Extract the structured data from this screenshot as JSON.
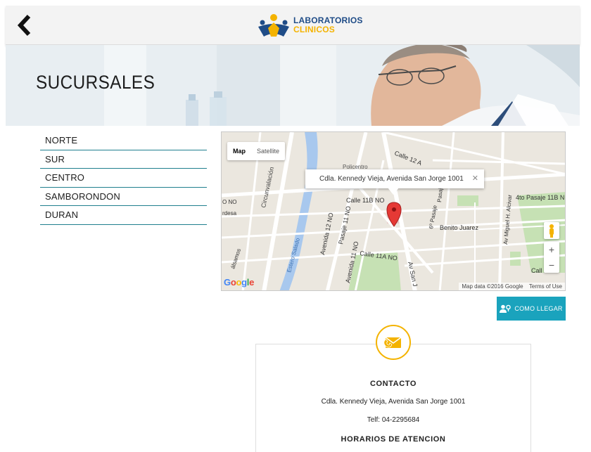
{
  "header": {
    "brand_line1": "LABORATORIOS",
    "brand_line2": "CLINICOS",
    "back_icon": "chevron-left-icon"
  },
  "hero": {
    "title": "SUCURSALES"
  },
  "branches": [
    "NORTE",
    "SUR",
    "CENTRO",
    "SAMBORONDON",
    "DURAN"
  ],
  "map": {
    "type_map": "Map",
    "type_satellite": "Satellite",
    "info_address": "Cdla. Kennedy Vieja, Avenida San Jorge 1001",
    "attribution": "Map data ©2016 Google",
    "terms": "Terms of Use",
    "google": "Google",
    "streets": {
      "policentro": "Policentro",
      "calle_12a": "Calle 12 A",
      "calle_11b": "Calle 11B NO",
      "calle_11a": "Calle 11A NO",
      "circunvalacion": "Circunvalación",
      "avenida_12": "Avenida 12 NO",
      "pasaje_11": "Pasaje 11 NO",
      "avenida_11": "Avenida 11 NO",
      "estero": "Estero Salado",
      "benito": "Benito Juarez",
      "pasaje_6": "6º Pasaje",
      "pasaje_9": "Pasaje 9",
      "av_miguel": "Av Miguel H. Alcivar",
      "pasaje_11b": "4to Pasaje 11B N",
      "av_san": "Av San J",
      "calle_short": "Call",
      "no": "O NO",
      "ardesa": "rdesa",
      "balsamos": "álsamos"
    },
    "zoom_in": "+",
    "zoom_out": "−",
    "colors": {
      "water": "#a8c8ee",
      "park": "#c6e1b4",
      "road": "#ffffff",
      "marker": "#e53935"
    }
  },
  "directions_button": "COMO LLEGAR",
  "contact": {
    "title": "CONTACTO",
    "address": "Cdla. Kennedy Vieja, Avenida San Jorge 1001",
    "phone": "Telf: 04-2295684",
    "hours_title": "HORARIOS DE ATENCION"
  },
  "colors": {
    "accent": "#1aa3bd",
    "brand_blue": "#1f4c87",
    "brand_yellow": "#f4b300",
    "divider": "#1f7f8e"
  }
}
